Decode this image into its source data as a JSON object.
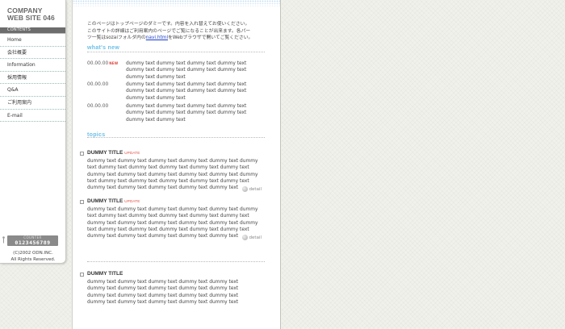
{
  "site": {
    "logo_line1": "COMPANY",
    "logo_line2": "WEB SITE 046",
    "contents_label": "CONTENTS",
    "nav": [
      "Home",
      "会社概要",
      "Information",
      "採用情報",
      "Q&A",
      "ご利用案内",
      "E-mail"
    ],
    "counter_label": "COUNTER",
    "counter_value": "0123456789",
    "copyright_line1": "(C)2002 ODN.INC.",
    "copyright_line2": "All Rights Reserved."
  },
  "intro": {
    "line1": "このページはトップページのダミーです。内容を入れ替えてお使いください。",
    "line2": "このサイトの詳細はご利用案内のページでご覧になることが出来ます。各パー",
    "line3_pre": "ツ一覧はsozaiフォルダ内の",
    "line3_link": "navi.html",
    "line3_post": "をWebブラウザで開いてご覧ください。"
  },
  "whats_new": {
    "heading": "what's new",
    "items": [
      {
        "date": "00.00.00",
        "badge": "NEW",
        "text": "dummy text dummy text dummy text dummy text dummy text dummy text dummy text dummy text dummy text dummy text"
      },
      {
        "date": "00.00.00",
        "badge": "",
        "text": "dummy text dummy text dummy text dummy text dummy text dummy text dummy text dummy text dummy text dummy text"
      },
      {
        "date": "00.00.00",
        "badge": "",
        "text": "dummy text dummy text dummy text dummy text dummy text dummy text dummy text dummy text dummy text dummy text"
      }
    ]
  },
  "topics": {
    "heading": "topics",
    "items": [
      {
        "title": "DUMMY TITLE",
        "badge": "UPDATE",
        "body": "dummy text dummy text dummy text dummy text dummy text dummy text dummy text dummy text dummy text dummy text dummy text dummy text dummy text dummy text dummy text dummy text dummy text dummy text dummy text dummy text dummy text dummy text dummy text dummy text dummy text dummy text dummy text",
        "detail": "detail"
      },
      {
        "title": "DUMMY TITLE",
        "badge": "UPDATE",
        "body": "dummy text dummy text dummy text dummy text dummy text dummy text dummy text dummy text dummy text dummy text dummy text dummy text dummy text dummy text dummy text dummy text dummy text dummy text dummy text dummy text dummy text dummy text dummy text dummy text dummy text dummy text dummy text",
        "detail": "detail"
      },
      {
        "title": "DUMMY TITLE",
        "badge": "",
        "body": "dummy text dummy text dummy text dummy text dummy text dummy text dummy text dummy text dummy text dummy text dummy text dummy text dummy text dummy text dummy text dummy text dummy text dummy text dummy text dummy text",
        "detail": ""
      }
    ]
  },
  "colors": {
    "accent": "#6cc0e8",
    "badge_red": "#e0433a",
    "link": "#1a3cc8",
    "sidebar_bar": "#6d6d6d"
  }
}
